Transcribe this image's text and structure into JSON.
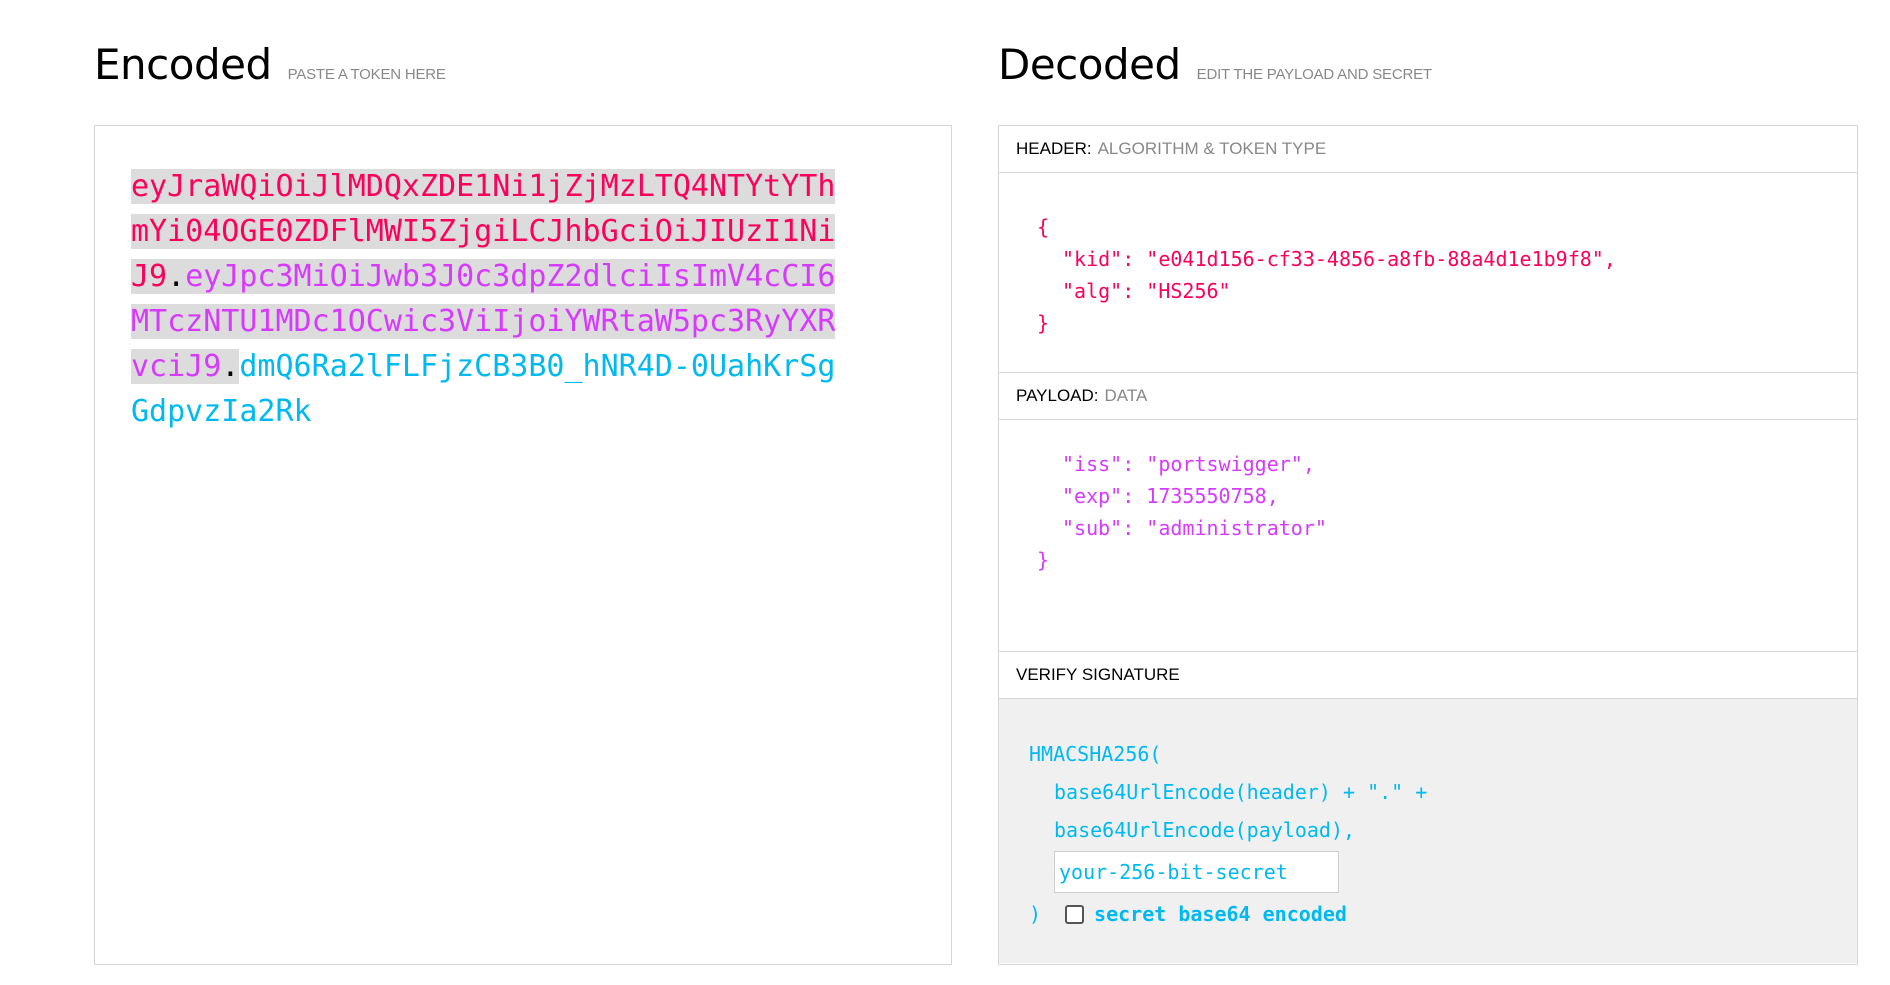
{
  "encoded": {
    "title": "Encoded",
    "subtitle": "PASTE A TOKEN HERE",
    "token": {
      "header": "eyJraWQiOiJlMDQxZDE1Ni1jZjMzLTQ4NTYtYThmYi04OGE0ZDFlMWI5ZjgiLCJhbGciOiJIUzI1NiJ9",
      "dot1": ".",
      "payload": "eyJpc3MiOiJwb3J0c3dpZ2dlciIsImV4cCI6MTczNTU1MDc1OCwic3ViIjoiYWRtaW5pc3RyYXRvciJ9",
      "dot2": ".",
      "signature": "dmQ6Ra2lFLFjzCB3B0_hNR4D-0UahKrSgGdpvzIa2Rk"
    }
  },
  "decoded": {
    "title": "Decoded",
    "subtitle": "EDIT THE PAYLOAD AND SECRET",
    "header_section": {
      "label": "HEADER:",
      "label_muted": "ALGORITHM & TOKEN TYPE",
      "lines": [
        "{",
        "\"kid\": \"e041d156-cf33-4856-a8fb-88a4d1e1b9f8\",",
        "\"alg\": \"HS256\"",
        "}"
      ]
    },
    "payload_section": {
      "label": "PAYLOAD:",
      "label_muted": "DATA",
      "lines": [
        "\"iss\": \"portswigger\",",
        "\"exp\": 1735550758,",
        "\"sub\": \"administrator\"",
        "}"
      ]
    },
    "verify_section": {
      "label": "VERIFY SIGNATURE",
      "fn_open": "HMACSHA256(",
      "line1": "base64UrlEncode(header) + \".\" +",
      "line2": "base64UrlEncode(payload),",
      "secret_placeholder": "your-256-bit-secret",
      "close_paren": ")",
      "checkbox_label": "secret base64 encoded"
    }
  },
  "colors": {
    "header": "#fb015b",
    "payload": "#d63aff",
    "signature": "#00b9f1"
  }
}
